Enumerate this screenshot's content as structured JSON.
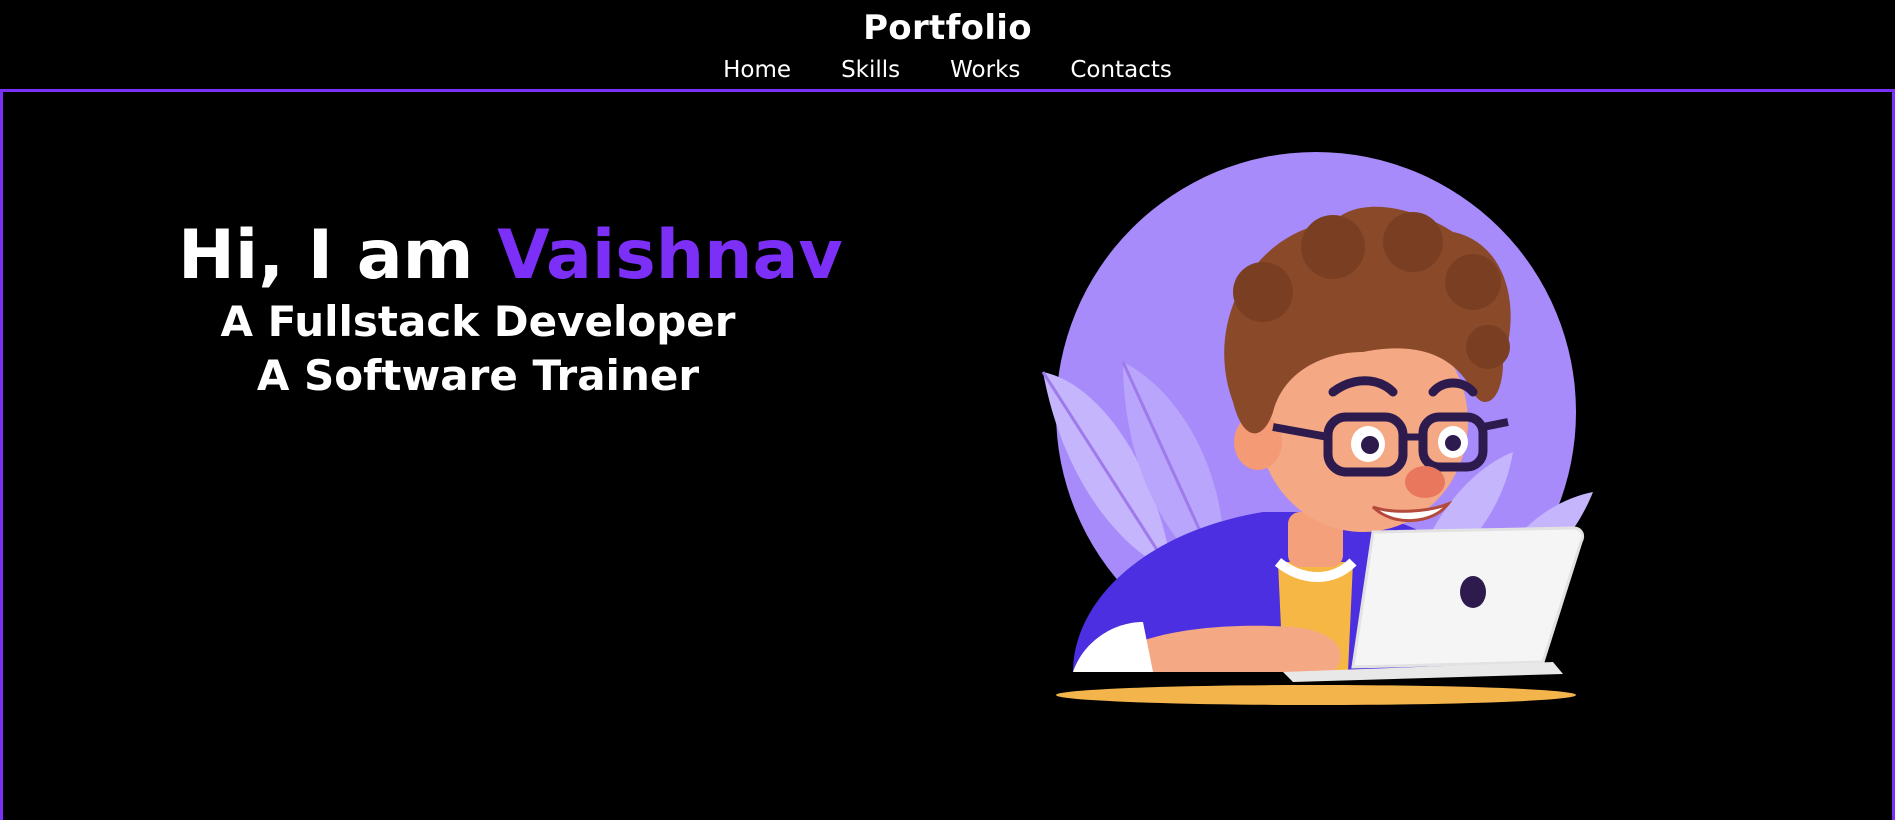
{
  "header": {
    "title": "Portfolio",
    "nav": [
      "Home",
      "Skills",
      "Works",
      "Contacts"
    ]
  },
  "hero": {
    "greeting_prefix": "Hi, I am ",
    "name": "Vaishnav",
    "roles": [
      "A Fullstack Developer",
      "A Software Trainer"
    ]
  },
  "colors": {
    "accent": "#7b2ff7",
    "background": "#000000",
    "text": "#ffffff"
  },
  "icons": {
    "illustration": "developer-at-laptop-illustration"
  }
}
